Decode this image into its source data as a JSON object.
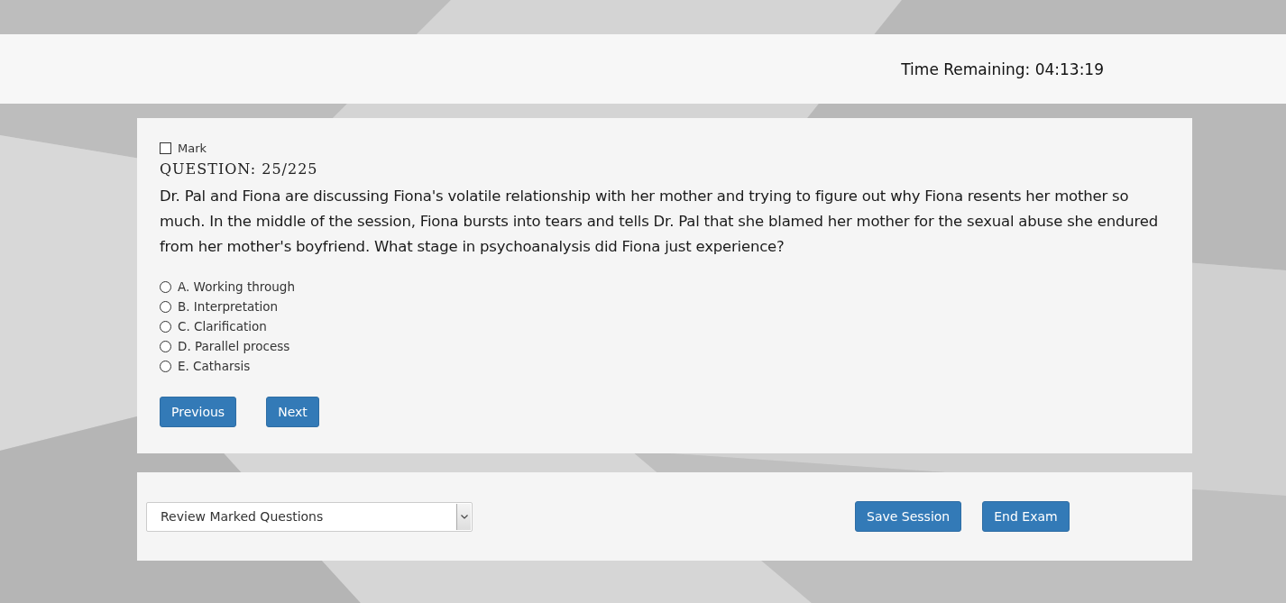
{
  "header": {
    "timer_label": "Time Remaining: 04:13:19"
  },
  "question": {
    "mark": {
      "label": "Mark",
      "checked": false
    },
    "number": "QUESTION: 25/225",
    "text": "Dr. Pal and Fiona are discussing Fiona's volatile relationship with her mother and trying to figure out why Fiona resents her mother so much. In the middle of the session, Fiona bursts into tears and tells Dr. Pal that she blamed her mother for the sexual abuse she endured from her mother's boyfriend. What stage in psychoanalysis did Fiona just experience?",
    "options": [
      {
        "label": "A. Working through",
        "selected": false
      },
      {
        "label": "B. Interpretation",
        "selected": false
      },
      {
        "label": "C. Clarification",
        "selected": false
      },
      {
        "label": "D. Parallel process",
        "selected": false
      },
      {
        "label": "E. Catharsis",
        "selected": false
      }
    ],
    "buttons": [
      "Previous",
      "Next"
    ]
  },
  "footer": {
    "review_select": {
      "value": "Review Marked Questions"
    },
    "buttons": [
      "Save Session",
      "End Exam"
    ]
  }
}
